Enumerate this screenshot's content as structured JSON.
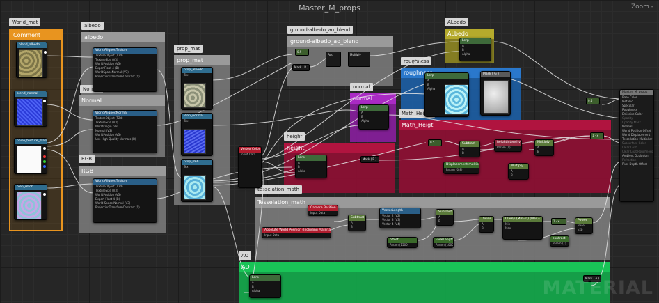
{
  "window": {
    "title": "Master_M_props",
    "zoom_label": "Zoom -"
  },
  "watermark": "MATERIAL",
  "tags": {
    "world_mat": "World_mat",
    "albedo": "albedo",
    "normal": "Normal",
    "rgb": "RGB",
    "prop_mat": "prop_mat",
    "ground_blend": "ground-albedo_ao_blend",
    "albedo_group": "ALbedo",
    "roughness": "roughness",
    "normal_group": "normal",
    "math_height": "Math_Height",
    "height": "height",
    "tesselation": "tesselation_math",
    "ao": "AO"
  },
  "comments": {
    "comment": "Comment",
    "albedo": "albedo",
    "normal": "Normal",
    "rgb": "RGB",
    "prop_mat": "prop_mat",
    "ground_blend": "ground-albedo_ao_blend",
    "albedo_group": "ALbedo",
    "roughness": "roughness",
    "normal_group": "normal",
    "math_height": "Math_Heigt",
    "height": "height",
    "tesselation": "Tesselation_math",
    "ao": "AO"
  },
  "nodes": {
    "tex_albedo": {
      "title": "blend_albedo",
      "sub": "Param Tex Object"
    },
    "tex_normal": {
      "title": "blend_normal",
      "sub": "Param Tex Object"
    },
    "tex_mask": {
      "title": "noise_texture_mask",
      "sub": "Param Tex Object"
    },
    "tex_rgb": {
      "title": "blen_rmdh",
      "sub": "Param Tex Object"
    },
    "wab_albedo": {
      "title": "WorldAlignedTexture",
      "rows": [
        "TextureObject (T2d)",
        "TextureSize (V3)",
        "WorldPosition (V3)",
        "ExportFloat 4 (B)",
        "WorldSpaceNormal (V3)",
        "ProjectionTransformContrast (S)"
      ],
      "outs": [
        "XY Texture",
        "Z Texture",
        "XYZ Texture"
      ]
    },
    "wab_normal": {
      "title": "WorldAlignedNormal",
      "rows": [
        "TextureObject (T2d)",
        "TextureSize (V3)",
        "WorldOrigin (V3)",
        "Normal (V3)",
        "WorldPosition (V3)",
        "Use High Quality Normals (B)"
      ],
      "outs": [
        "XY Texture",
        "XY Texture",
        "XYZNotTop",
        "Z Texture"
      ]
    },
    "wab_rgb": {
      "title": "WorldAlignedTexture",
      "rows": [
        "TextureObject (T2d)",
        "TextureSize (V3)",
        "WorldPosition (V3)",
        "Export Float 4 (B)",
        "World Space Normal (V3)",
        "ProjectionTransformContrast (S)"
      ],
      "outs": [
        "XY Texture",
        "Z Texture",
        "XYZ Texture"
      ]
    },
    "prop_albedo": {
      "title": "prop_albedo",
      "sub": "Param Tex",
      "pins": [
        "Tex",
        "RGB",
        "R",
        "G",
        "B",
        "A"
      ]
    },
    "prop_normal": {
      "title": "Prop_normal",
      "sub": "Param Tex",
      "pins": [
        "Tex",
        "RGB",
        "R",
        "G",
        "B",
        "A"
      ]
    },
    "prop_rmh": {
      "title": "prop_rmh",
      "sub": "Param Tex",
      "pins": [
        "Tex",
        "RGB",
        "R",
        "G",
        "B",
        "A"
      ]
    },
    "lerp_ground_a": {
      "title": "0.5"
    },
    "lerp_ground_b": {
      "title": "Mask ( R )"
    },
    "multiply_ground": {
      "title": "Multiply"
    },
    "add_ground": {
      "title": "Add"
    },
    "lerp_albedo": {
      "title": "Lerp",
      "pins": [
        "A",
        "B",
        "Alpha"
      ]
    },
    "lerp_rough": {
      "title": "Lerp",
      "pins": [
        "A",
        "B",
        "Alpha"
      ]
    },
    "mask_rough": {
      "title": "Mask ( G )"
    },
    "lerp_normal": {
      "title": "Lerp",
      "pins": [
        "A",
        "B",
        "Alpha"
      ]
    },
    "vertex_color": {
      "title": "Vertex Color",
      "sub": "Input Data"
    },
    "lerp_height": {
      "title": "Lerp",
      "pins": [
        "A",
        "B",
        "Alpha"
      ]
    },
    "mask_height": {
      "title": "Mask ( B )"
    },
    "math_const": {
      "title": "0.5"
    },
    "subtract_mh": {
      "title": "Subtract",
      "pins": [
        "A",
        "B"
      ]
    },
    "height_param": {
      "title": "heightIntensityMult",
      "sub": "Param (1)"
    },
    "multiply_mh": {
      "title": "Multiply",
      "pins": [
        "A",
        "B"
      ]
    },
    "displacement": {
      "title": "Displacement multiplier_offset",
      "sub": "Param (0.8)"
    },
    "multiply_mh2": {
      "title": "Multiply",
      "pins": [
        "A",
        "B"
      ]
    },
    "camera_pos": {
      "title": "Camera Position",
      "sub": "Input Data"
    },
    "abs_world_pos": {
      "title": "Absolute World Position (Including Material Offsets)",
      "sub": "Input Data"
    },
    "subtract_t": {
      "title": "Subtract",
      "pins": [
        "A",
        "B"
      ]
    },
    "vector_length": {
      "title": "VectorLength",
      "pins": [
        "Vector 2 (V2)",
        "Vector 3 (V3)",
        "Vector 4 (V4)"
      ],
      "outs": [
        "V2 Length",
        "V3 Length",
        "V4 Length"
      ]
    },
    "subtract_t2": {
      "title": "Subtract",
      "pins": [
        "A",
        "B"
      ]
    },
    "offset_param": {
      "title": "offset",
      "sub": "Param (1500)"
    },
    "fade_length": {
      "title": "FadeLength",
      "sub": "Param (1000)"
    },
    "divide_t": {
      "title": "Divide",
      "pins": [
        "A",
        "B"
      ]
    },
    "clamp_t": {
      "title": "Clamp (Min=0) (Max=1)",
      "pins": [
        "Min",
        "Max"
      ]
    },
    "one_minus": {
      "title": "1 - x"
    },
    "power_t": {
      "title": "Power",
      "pins": [
        "Base",
        "Exp"
      ]
    },
    "contrast_param": {
      "title": "contrast",
      "sub": "Param (1)"
    },
    "lerp_ao": {
      "title": "Lerp",
      "pins": [
        "A",
        "B",
        "Alpha"
      ]
    },
    "mask_ao": {
      "title": "Mask ( A )"
    },
    "out_05": {
      "title": "0.5"
    },
    "height_lerp_out": {
      "title": "1 - x"
    },
    "result": {
      "title": "Master_M_props",
      "pins": [
        "Base Color",
        "Metallic",
        "Specular",
        "Roughness",
        "Emissive Color",
        "Opacity",
        "Opacity Mask",
        "Normal",
        "World Position Offset",
        "World Displacement",
        "Tessellation Multiplier",
        "Subsurface Color",
        "Clear Coat",
        "Clear Coat Roughness",
        "Ambient Occlusion",
        "Refraction",
        "Pixel Depth Offset"
      ]
    }
  },
  "colors": {
    "comment_orange": "#e8941f",
    "albedo_yellow": "#8f8722",
    "roughness_blue": "#1d5fa6",
    "normal_purple": "#8a1f9e",
    "math_red": "#8e0f33",
    "height_red": "#8e0f33",
    "ao_green": "#14a84b",
    "gray_group": "#7e7e7e"
  }
}
